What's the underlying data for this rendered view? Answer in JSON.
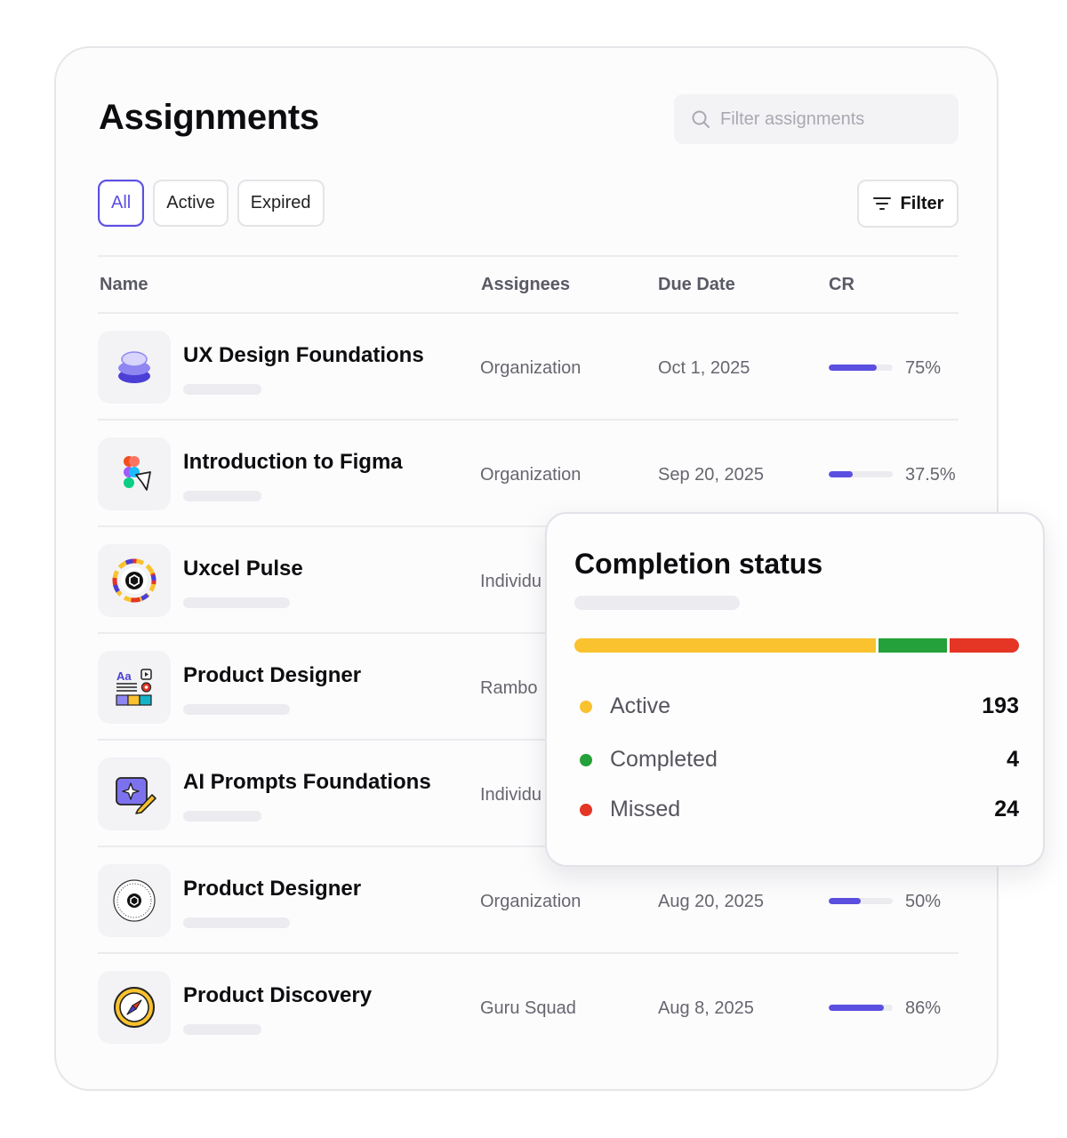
{
  "header": {
    "title": "Assignments",
    "search_placeholder": "Filter assignments"
  },
  "tabs": [
    {
      "label": "All",
      "selected": true
    },
    {
      "label": "Active",
      "selected": false
    },
    {
      "label": "Expired",
      "selected": false
    }
  ],
  "filter_button": {
    "label": "Filter",
    "icon": "filter-lines-icon"
  },
  "table": {
    "columns": [
      "Name",
      "Assignees",
      "Due Date",
      "CR"
    ],
    "rows": [
      {
        "name": "UX Design Foundations",
        "icon": "layers-stack-icon",
        "assignee": "Organization",
        "due": "Oct 1, 2025",
        "cr": "75%",
        "cr_value": 0.75
      },
      {
        "name": "Introduction to Figma",
        "icon": "figma-logo-icon",
        "assignee": "Organization",
        "due": "Sep 20, 2025",
        "cr": "37.5%",
        "cr_value": 0.375
      },
      {
        "name": "Uxcel Pulse",
        "icon": "pulse-badge-icon",
        "assignee": "Individu",
        "due": "",
        "cr": "",
        "cr_value": null
      },
      {
        "name": "Product Designer",
        "icon": "design-kit-icon",
        "assignee": "Rambo",
        "due": "",
        "cr": "",
        "cr_value": null
      },
      {
        "name": "AI Prompts Foundations",
        "icon": "ai-sparkle-pencil-icon",
        "assignee": "Individu",
        "due": "",
        "cr": "",
        "cr_value": null
      },
      {
        "name": "Product Designer",
        "icon": "certificate-seal-icon",
        "assignee": "Organization",
        "due": "Aug 20, 2025",
        "cr": "50%",
        "cr_value": 0.5
      },
      {
        "name": "Product Discovery",
        "icon": "compass-icon",
        "assignee": "Guru Squad",
        "due": "Aug 8, 2025",
        "cr": "86%",
        "cr_value": 0.86
      }
    ]
  },
  "completion": {
    "title": "Completion status",
    "items": [
      {
        "label": "Active",
        "value": "193",
        "count": 193,
        "color": "#f9c22e"
      },
      {
        "label": "Completed",
        "value": "4",
        "count": 4,
        "color": "#24a13a"
      },
      {
        "label": "Missed",
        "value": "24",
        "count": 24,
        "color": "#e53524"
      }
    ]
  },
  "colors": {
    "accent": "#5b4fe0"
  }
}
